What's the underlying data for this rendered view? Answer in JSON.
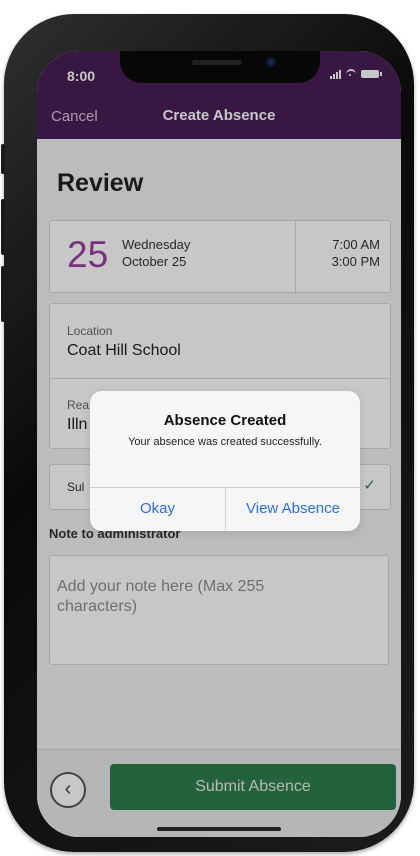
{
  "status_bar": {
    "time": "8:00"
  },
  "nav": {
    "cancel_label": "Cancel",
    "title": "Create Absence"
  },
  "page": {
    "heading": "Review"
  },
  "date_card": {
    "day_number": "25",
    "weekday": "Wednesday",
    "date": "October 25",
    "start_time": "7:00 AM",
    "end_time": "3:00 PM"
  },
  "details": {
    "location_label": "Location",
    "location_value": "Coat Hill School",
    "reason_label_partial": "Rea",
    "reason_value_partial": "Illn"
  },
  "substitute": {
    "label_partial": "Sul"
  },
  "note": {
    "label": "Note to administrator",
    "placeholder": "Add your note here (Max 255 characters)"
  },
  "footer": {
    "submit_label": "Submit Absence"
  },
  "alert": {
    "title": "Absence Created",
    "message": "Your absence was created successfully.",
    "okay_label": "Okay",
    "view_label": "View Absence"
  },
  "colors": {
    "header": "#4a1e57",
    "accent_day": "#9b3fa0",
    "submit": "#2f7e4d",
    "alert_button": "#2b6fe0"
  }
}
